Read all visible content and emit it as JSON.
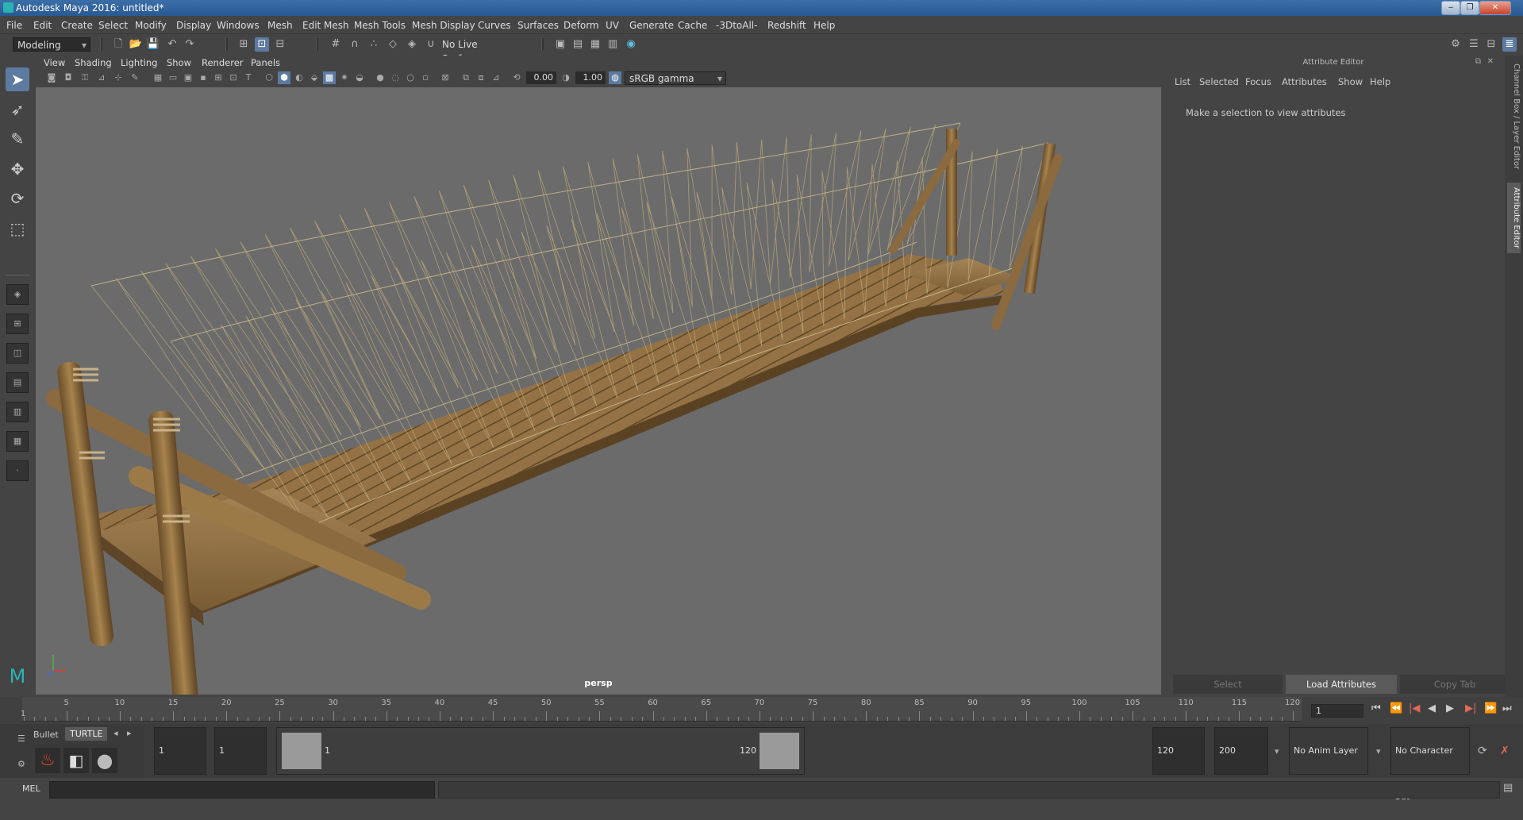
{
  "title_bar": {
    "title": "Autodesk Maya 2016: untitled*"
  },
  "menu": [
    "File",
    "Edit",
    "Create",
    "Select",
    "Modify",
    "Display",
    "Windows",
    "Mesh",
    "Edit Mesh",
    "Mesh Tools",
    "Mesh Display",
    "Curves",
    "Surfaces",
    "Deform",
    "UV",
    "Generate",
    "Cache",
    "-3DtoAll-",
    "Redshift",
    "Help"
  ],
  "shelf": {
    "mode": "Modeling",
    "live_surface": "No Live Surface"
  },
  "viewport": {
    "menu": [
      "View",
      "Shading",
      "Lighting",
      "Show",
      "Renderer",
      "Panels"
    ],
    "exposure": "0.00",
    "gamma": "1.00",
    "color_space": "sRGB gamma",
    "camera": "persp"
  },
  "attribute_editor": {
    "header": "Attribute Editor",
    "menu": [
      "List",
      "Selected",
      "Focus",
      "Attributes",
      "Show",
      "Help"
    ],
    "message": "Make a selection to view attributes",
    "buttons": [
      "Select",
      "Load Attributes",
      "Copy Tab"
    ]
  },
  "side_tabs": [
    "Channel Box / Layer Editor",
    "Attribute Editor"
  ],
  "timeline": {
    "ticks": [
      "5",
      "10",
      "15",
      "20",
      "25",
      "30",
      "35",
      "40",
      "45",
      "50",
      "55",
      "60",
      "65",
      "70",
      "75",
      "80",
      "85",
      "90",
      "95",
      "100",
      "105",
      "110",
      "115",
      "120"
    ],
    "start_marker": "1",
    "current_frame": "1"
  },
  "range": {
    "shelf_tabs": [
      "Bullet",
      "TURTLE"
    ],
    "start_time": "1",
    "playback_start": "1",
    "slider_start": "1",
    "slider_end": "120",
    "playback_end": "120",
    "end_time": "200",
    "anim_layer": "No Anim Layer",
    "character_set": "No Character Set"
  },
  "command_line": {
    "label": "MEL"
  },
  "colors": {
    "accent": "#5d7ba0",
    "viewport_bg": "#6b6b6b",
    "panel_bg": "#444444",
    "wood": "#8a6a3e"
  }
}
